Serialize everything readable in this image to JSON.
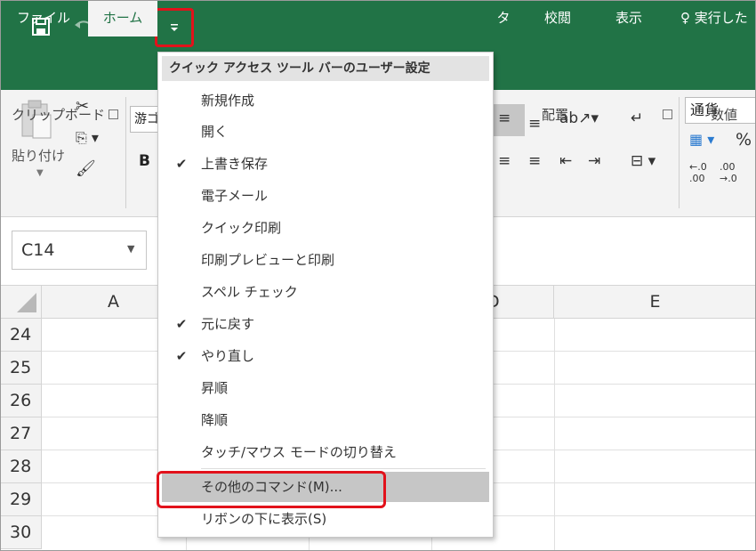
{
  "qat": {
    "save_icon": "save-icon",
    "undo_icon": "undo-icon",
    "redo_icon": "redo-icon",
    "customize_icon": "customize-caret-icon"
  },
  "tabs": [
    {
      "label": "ファイル"
    },
    {
      "label": "ホーム"
    },
    {
      "label": "タ"
    },
    {
      "label": "校閲"
    },
    {
      "label": "表示"
    },
    {
      "label": "実行した"
    }
  ],
  "ribbon": {
    "clipboard": {
      "paste_label": "貼り付け",
      "group_label": "クリップボード"
    },
    "font": {
      "font_name": "游ゴ",
      "bold": "B"
    },
    "alignment": {
      "group_label": "配置"
    },
    "number": {
      "format": "通貨",
      "group_label": "数値",
      "percent": "%"
    }
  },
  "formula_bar": {
    "name_box": "C14"
  },
  "grid": {
    "columns": [
      "A",
      "D",
      "E"
    ],
    "rows": [
      "24",
      "25",
      "26",
      "27",
      "28",
      "29",
      "30"
    ]
  },
  "menu": {
    "title": "クイック アクセス ツール バーのユーザー設定",
    "items": [
      {
        "label": "新規作成",
        "checked": false
      },
      {
        "label": "開く",
        "checked": false
      },
      {
        "label": "上書き保存",
        "checked": true
      },
      {
        "label": "電子メール",
        "checked": false
      },
      {
        "label": "クイック印刷",
        "checked": false
      },
      {
        "label": "印刷プレビューと印刷",
        "checked": false
      },
      {
        "label": "スペル チェック",
        "checked": false
      },
      {
        "label": "元に戻す",
        "checked": true
      },
      {
        "label": "やり直し",
        "checked": true
      },
      {
        "label": "昇順",
        "checked": false
      },
      {
        "label": "降順",
        "checked": false
      },
      {
        "label": "タッチ/マウス モードの切り替え",
        "checked": false
      },
      {
        "label": "その他のコマンド(M)...",
        "checked": false,
        "highlighted": true
      },
      {
        "label": "リボンの下に表示(S)",
        "checked": false
      }
    ],
    "check_glyph": "✔"
  },
  "colors": {
    "excel_green": "#217346",
    "highlight_red": "#e2121b",
    "menu_hover": "#c6c6c6"
  }
}
